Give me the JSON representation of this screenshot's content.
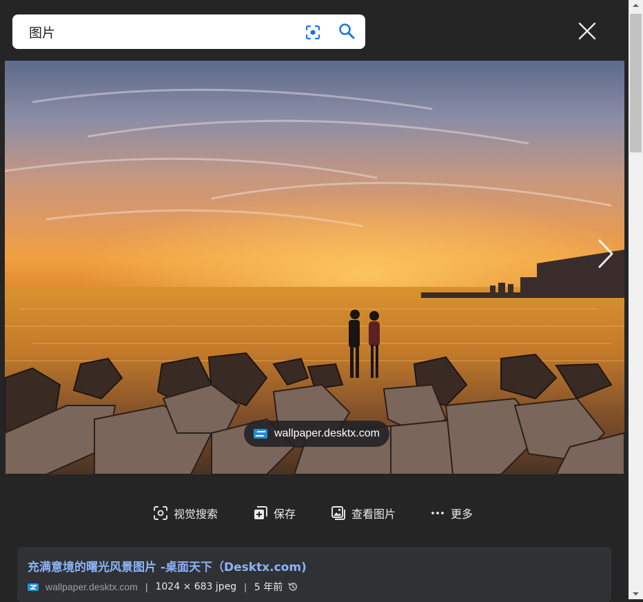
{
  "search": {
    "query": "图片"
  },
  "preview": {
    "source_domain": "wallpaper.desktx.com"
  },
  "actions": [
    {
      "label": "视觉搜索",
      "icon": "lens-icon"
    },
    {
      "label": "保存",
      "icon": "save-icon"
    },
    {
      "label": "查看图片",
      "icon": "view-image-icon"
    },
    {
      "label": "更多",
      "icon": "more-icon"
    }
  ],
  "result": {
    "title": "充满意境的曙光风景图片 -桌面天下（Desktx.com)",
    "domain": "wallpaper.desktx.com",
    "dimensions": "1024 × 683 jpeg",
    "age": "5 年前"
  },
  "colors": {
    "accent": "#1a73e8",
    "title_link": "#8ab4f8",
    "background": "#252526"
  }
}
